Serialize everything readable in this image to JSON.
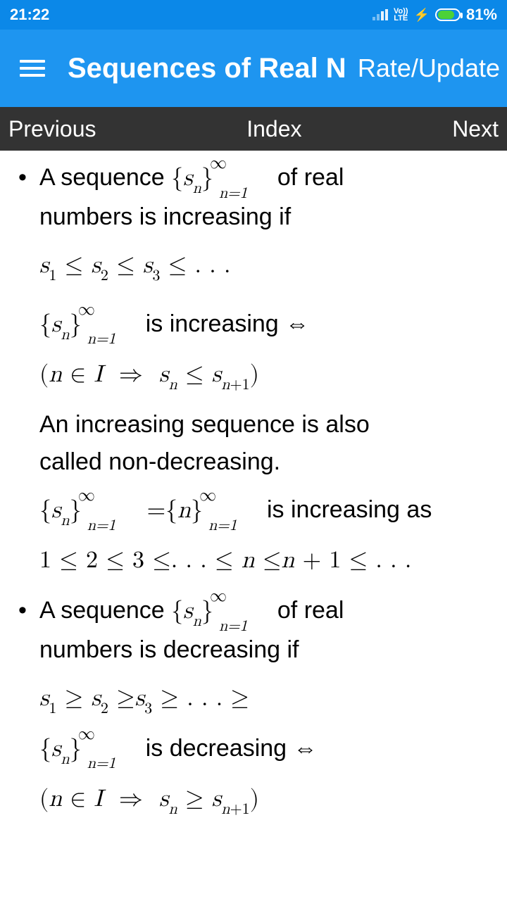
{
  "status": {
    "time": "21:22",
    "network_label": "Vo)) LTE",
    "charging_icon": "⚡",
    "battery_pct": "81%",
    "battery_fill": "81%"
  },
  "appbar": {
    "title": "Sequences of Real N…",
    "action": "Rate/Update"
  },
  "nav": {
    "prev": "Previous",
    "index": "Index",
    "next": "Next"
  },
  "content": {
    "item1": {
      "line1_pre": "A sequence ",
      "seq_open": "{",
      "seq_var": "s",
      "seq_idx": "n",
      "seq_close": "}",
      "seq_sup": "∞",
      "seq_sub": "n=1",
      "line1_post": " of real",
      "line2": "numbers is increasing if",
      "ineq1": "s₁ ≤ s₂ ≤ s₃ ≤ . . .",
      "incr_label": " is increasing  ⇔",
      "impl": "(n ∈ I  ⇒  sₙ ≤ sₙ₊₁)",
      "nondecr1": "An increasing sequence is also",
      "nondecr2": "called non-decreasing.",
      "eq_mid": " =",
      "n_open": "{",
      "n_var": "n",
      "n_close": "}",
      "ex_post": " is increasing as",
      "chain": "1 ≤ 2 ≤ 3 ≤. . . ≤ n ≤n + 1 ≤ . . ."
    },
    "item2": {
      "line1_pre": "A sequence ",
      "line1_post": " of real",
      "line2": "numbers is decreasing if",
      "ineq2": "s₁ ≥ s₂ ≥s₃ ≥ . . . ≥",
      "decr_label": " is decreasing  ⇔",
      "impl2": "(n ∈ I  ⇒  sₙ ≥ sₙ₊₁)"
    }
  }
}
